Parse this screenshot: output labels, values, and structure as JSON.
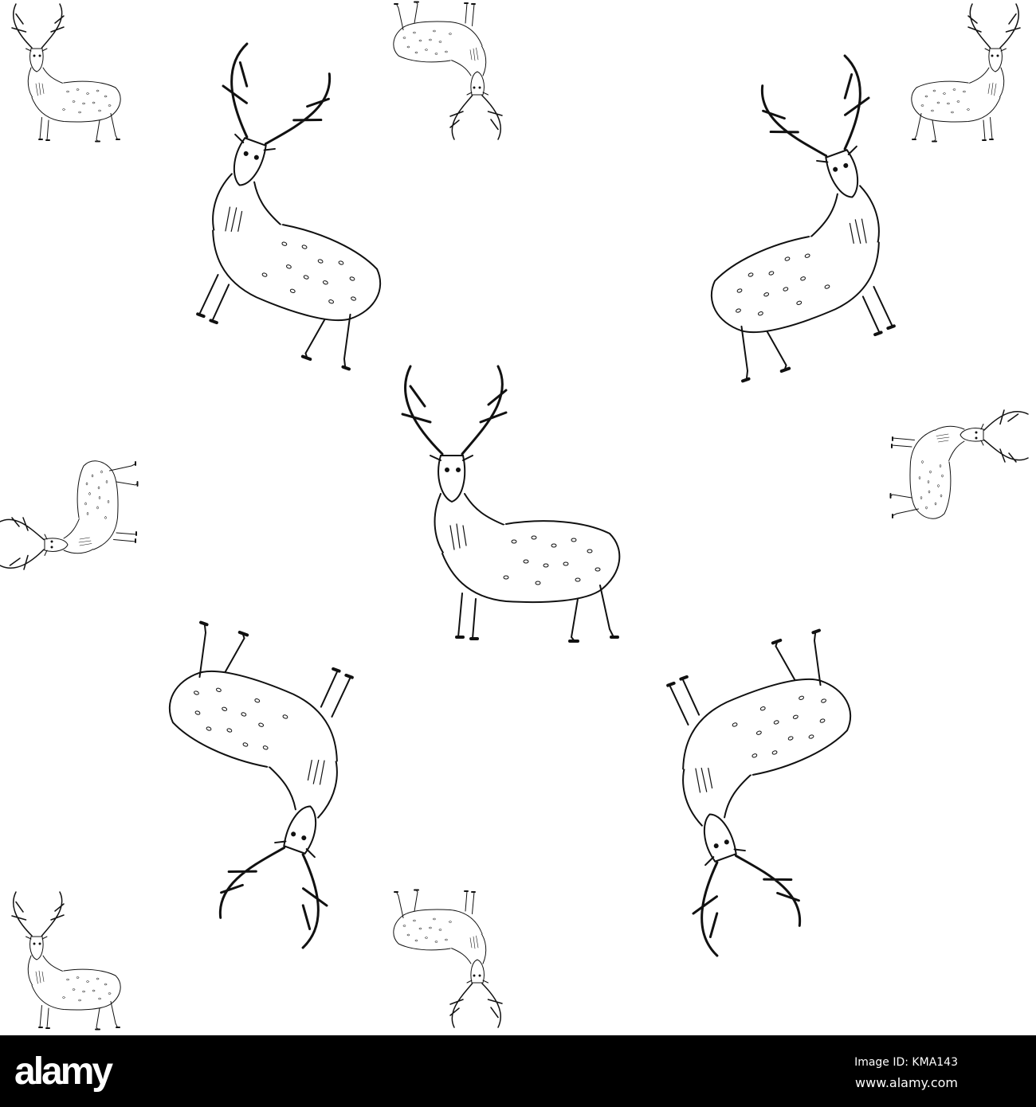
{
  "image": {
    "subject": "deer-pattern",
    "colors": {
      "ink": "#111111",
      "background": "#ffffff",
      "bar": "#000000"
    }
  },
  "watermark": {
    "logo": "alamy",
    "image_id": "Image ID: KMA143",
    "site": "www.alamy.com"
  }
}
